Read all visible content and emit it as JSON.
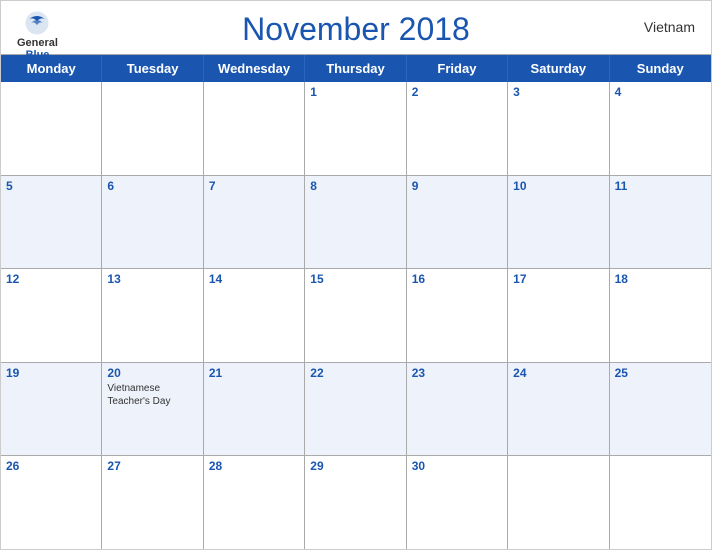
{
  "header": {
    "title": "November 2018",
    "country": "Vietnam",
    "logo_general": "General",
    "logo_blue": "Blue"
  },
  "days_of_week": [
    "Monday",
    "Tuesday",
    "Wednesday",
    "Thursday",
    "Friday",
    "Saturday",
    "Sunday"
  ],
  "weeks": [
    [
      {
        "day": "",
        "events": []
      },
      {
        "day": "",
        "events": []
      },
      {
        "day": "",
        "events": []
      },
      {
        "day": "1",
        "events": []
      },
      {
        "day": "2",
        "events": []
      },
      {
        "day": "3",
        "events": []
      },
      {
        "day": "4",
        "events": []
      }
    ],
    [
      {
        "day": "5",
        "events": []
      },
      {
        "day": "6",
        "events": []
      },
      {
        "day": "7",
        "events": []
      },
      {
        "day": "8",
        "events": []
      },
      {
        "day": "9",
        "events": []
      },
      {
        "day": "10",
        "events": []
      },
      {
        "day": "11",
        "events": []
      }
    ],
    [
      {
        "day": "12",
        "events": []
      },
      {
        "day": "13",
        "events": []
      },
      {
        "day": "14",
        "events": []
      },
      {
        "day": "15",
        "events": []
      },
      {
        "day": "16",
        "events": []
      },
      {
        "day": "17",
        "events": []
      },
      {
        "day": "18",
        "events": []
      }
    ],
    [
      {
        "day": "19",
        "events": []
      },
      {
        "day": "20",
        "events": [
          "Vietnamese Teacher's Day"
        ]
      },
      {
        "day": "21",
        "events": []
      },
      {
        "day": "22",
        "events": []
      },
      {
        "day": "23",
        "events": []
      },
      {
        "day": "24",
        "events": []
      },
      {
        "day": "25",
        "events": []
      }
    ],
    [
      {
        "day": "26",
        "events": []
      },
      {
        "day": "27",
        "events": []
      },
      {
        "day": "28",
        "events": []
      },
      {
        "day": "29",
        "events": []
      },
      {
        "day": "30",
        "events": []
      },
      {
        "day": "",
        "events": []
      },
      {
        "day": "",
        "events": []
      }
    ]
  ]
}
